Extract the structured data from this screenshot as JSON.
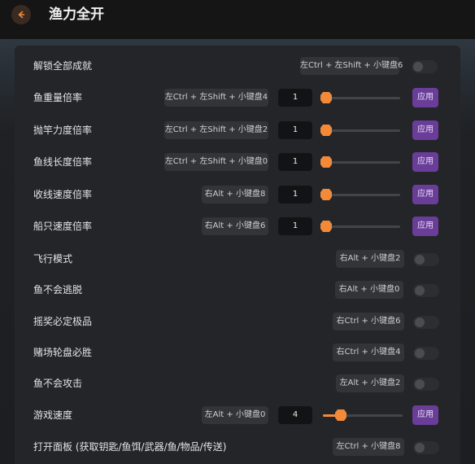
{
  "header": {
    "back_label": "<",
    "title": "渔力全开"
  },
  "colors": {
    "accent_orange": "#f28a3a",
    "apply_purple": "#6a3d99",
    "panel_bg": "#242528"
  },
  "rows": [
    {
      "label": "解锁全部成就",
      "hotkey": "左Ctrl + 左Shift + 小键盘6",
      "type": "toggle"
    },
    {
      "label": "鱼重量倍率",
      "hotkey": "左Ctrl + 左Shift + 小键盘4",
      "type": "slider",
      "value": "1",
      "level": 0.0,
      "apply_label": "应用"
    },
    {
      "label": "抛竿力度倍率",
      "hotkey": "左Ctrl + 左Shift + 小键盘2",
      "type": "slider",
      "value": "1",
      "level": 0.0,
      "apply_label": "应用"
    },
    {
      "label": "鱼线长度倍率",
      "hotkey": "左Ctrl + 左Shift + 小键盘0",
      "type": "slider",
      "value": "1",
      "level": 0.0,
      "apply_label": "应用"
    },
    {
      "label": "收线速度倍率",
      "hotkey": "右Alt + 小键盘8",
      "type": "slider",
      "value": "1",
      "level": 0.0,
      "apply_label": "应用"
    },
    {
      "label": "船只速度倍率",
      "hotkey": "右Alt + 小键盘6",
      "type": "slider",
      "value": "1",
      "level": 0.0,
      "apply_label": "应用"
    },
    {
      "label": "飞行模式",
      "hotkey": "右Alt + 小键盘2",
      "type": "toggle"
    },
    {
      "label": "鱼不会逃脱",
      "hotkey": "右Alt + 小键盘0",
      "type": "toggle"
    },
    {
      "label": "摇奖必定极品",
      "hotkey": "右Ctrl + 小键盘6",
      "type": "toggle"
    },
    {
      "label": "赌场轮盘必胜",
      "hotkey": "右Ctrl + 小键盘4",
      "type": "toggle"
    },
    {
      "label": "鱼不会攻击",
      "hotkey": "左Alt + 小键盘2",
      "type": "toggle"
    },
    {
      "label": "游戏速度",
      "hotkey": "左Alt + 小键盘0",
      "type": "slider",
      "value": "4",
      "level": 0.18,
      "apply_label": "应用"
    },
    {
      "label": "打开面板 (获取钥匙/鱼饵/武器/鱼/物品/传送)",
      "hotkey": "左Ctrl + 小键盘8",
      "type": "toggle"
    }
  ]
}
